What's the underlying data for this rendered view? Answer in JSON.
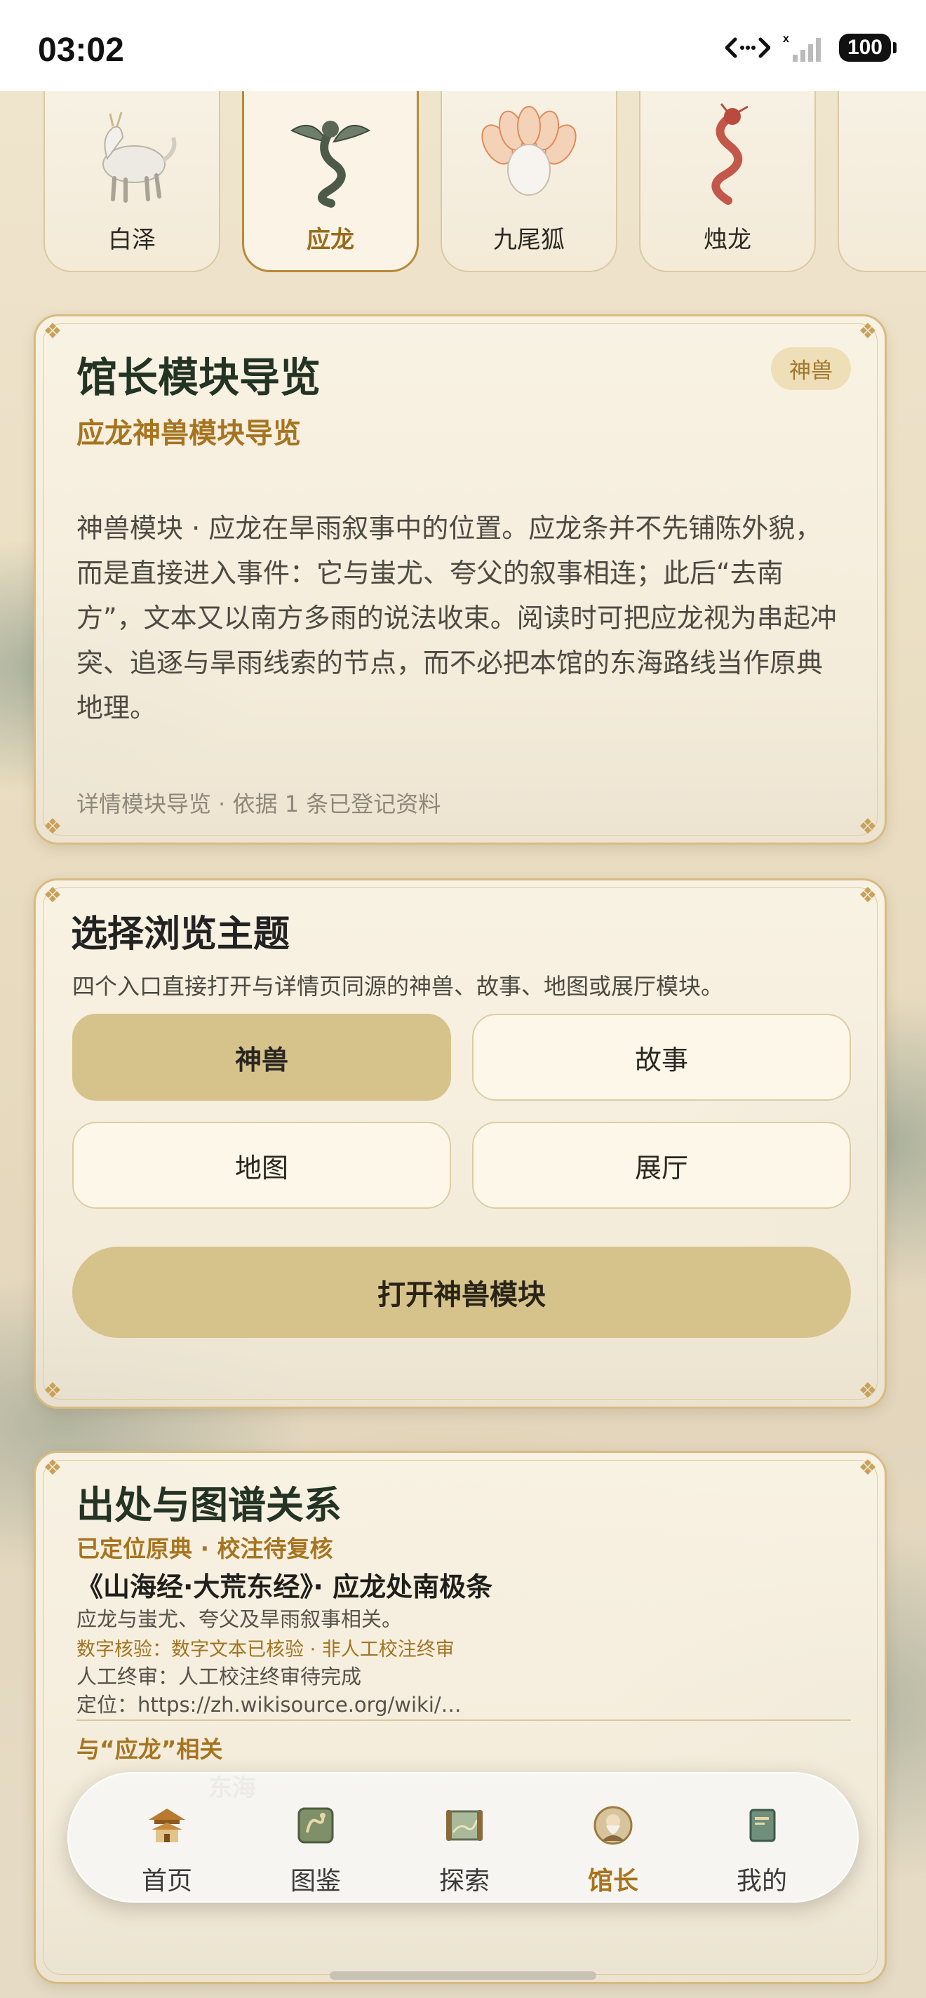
{
  "status_bar": {
    "time": "03:02",
    "battery": "100",
    "icons": [
      "data-transfer-icon",
      "signal-none-icon",
      "battery-icon"
    ]
  },
  "creatures": [
    {
      "label": "白泽",
      "active": false
    },
    {
      "label": "应龙",
      "active": true
    },
    {
      "label": "九尾狐",
      "active": false
    },
    {
      "label": "烛龙",
      "active": false
    }
  ],
  "guide_card": {
    "title": "馆长模块导览",
    "badge": "神兽",
    "subtitle": "应龙神兽模块导览",
    "body": "神兽模块 · 应龙在旱雨叙事中的位置。应龙条并不先铺陈外貌，而是直接进入事件：它与蚩尤、夸父的叙事相连；此后“去南方”，文本又以南方多雨的说法收束。阅读时可把应龙视为串起冲突、追逐与旱雨线索的节点，而不必把本馆的东海路线当作原典地理。",
    "footer": "详情模块导览 · 依据 1 条已登记资料"
  },
  "topic_card": {
    "title": "选择浏览主题",
    "description": "四个入口直接打开与详情页同源的神兽、故事、地图或展厅模块。",
    "topics": [
      {
        "label": "神兽",
        "selected": true
      },
      {
        "label": "故事",
        "selected": false
      },
      {
        "label": "地图",
        "selected": false
      },
      {
        "label": "展厅",
        "selected": false
      }
    ],
    "open_button": "打开神兽模块"
  },
  "source_card": {
    "title": "出处与图谱关系",
    "status": "已定位原典 · 校注待复核",
    "source": "《山海经·大荒东经》· 应龙处南极条",
    "summary": "应龙与蚩尤、夸父及旱雨叙事相关。",
    "digital_check": "数字核验：数字文本已核验 · 非人工校注终审",
    "manual_review": "人工终审：人工校注终审待完成",
    "location": "定位：https://zh.wikisource.org/wiki/…",
    "related_heading": "与“应龙”相关",
    "related_item": "东海"
  },
  "bottom_nav": [
    {
      "label": "首页",
      "icon": "pavilion-icon",
      "active": false
    },
    {
      "label": "图鉴",
      "icon": "bestiary-icon",
      "active": false
    },
    {
      "label": "探索",
      "icon": "scroll-map-icon",
      "active": false
    },
    {
      "label": "馆长",
      "icon": "curator-icon",
      "active": true
    },
    {
      "label": "我的",
      "icon": "book-icon",
      "active": false
    }
  ],
  "colors": {
    "accent_gold": "#a7741f",
    "button_fill": "#d6c38b",
    "title_green": "#243424"
  }
}
